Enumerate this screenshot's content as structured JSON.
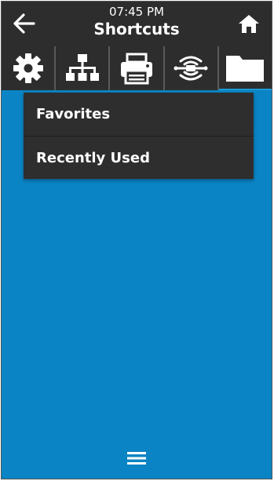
{
  "header": {
    "time": "07:45 PM",
    "title": "Shortcuts",
    "back_icon": "arrow-left-icon",
    "home_icon": "home-icon"
  },
  "tabs": [
    {
      "icon": "gear-icon",
      "active": false
    },
    {
      "icon": "network-icon",
      "active": false
    },
    {
      "icon": "printer-icon",
      "active": false
    },
    {
      "icon": "rfid-icon",
      "active": false
    },
    {
      "icon": "folder-icon",
      "active": true
    }
  ],
  "menu": {
    "items": [
      {
        "label": "Favorites"
      },
      {
        "label": "Recently Used"
      }
    ]
  },
  "footer": {
    "menu_icon": "hamburger-menu-icon"
  },
  "colors": {
    "background": "#0a84c4",
    "bar": "#2d2d2d",
    "menu": "#2e2e2e",
    "text": "#ffffff"
  }
}
